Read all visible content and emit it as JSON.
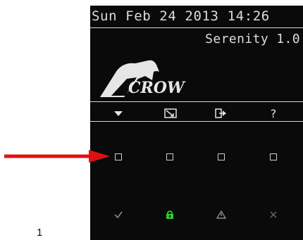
{
  "status_bar": {
    "datetime": "Sun Feb 24 2013 14:26"
  },
  "header": {
    "version": "Serenity 1.0"
  },
  "brand": {
    "logo_text": "CROW"
  },
  "toolbar": {
    "items": [
      {
        "icon": "chevron-down-icon"
      },
      {
        "icon": "edit-box-icon"
      },
      {
        "icon": "exit-icon"
      },
      {
        "icon": "help-icon",
        "label": "?"
      }
    ]
  },
  "keys": {
    "count": 4
  },
  "status_icons": [
    {
      "icon": "check-icon",
      "color": "#8a8a8a"
    },
    {
      "icon": "lock-icon",
      "color": "#2ecc2e"
    },
    {
      "icon": "warning-icon",
      "color": "#8a8a8a"
    },
    {
      "icon": "close-icon",
      "color": "#6a6a6a"
    }
  ],
  "annotation": {
    "arrow_color": "#e01010",
    "footnote": "1"
  }
}
